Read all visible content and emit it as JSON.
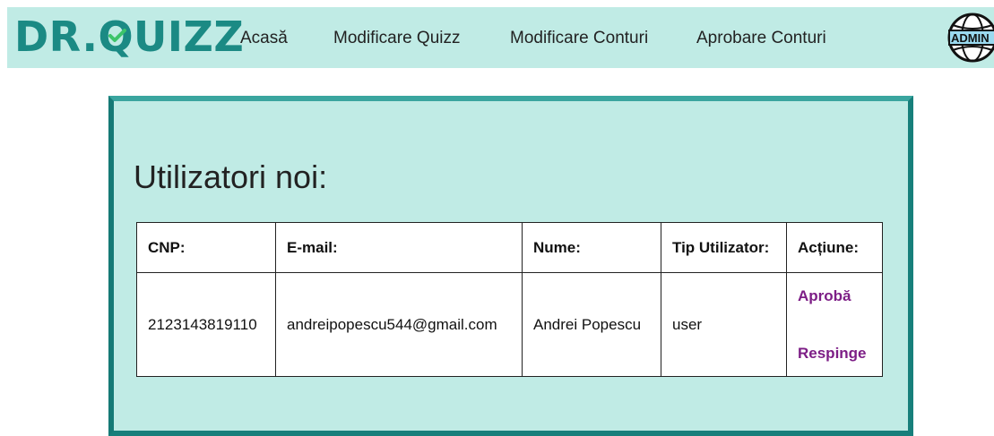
{
  "header": {
    "logo_text": "DR.QUIZZ",
    "nav": [
      {
        "label": "Acasă"
      },
      {
        "label": "Modificare Quizz"
      },
      {
        "label": "Modificare Conturi"
      },
      {
        "label": "Aprobare Conturi"
      }
    ],
    "admin_badge_text": "ADMIN"
  },
  "main": {
    "title": "Utilizatori noi:",
    "table": {
      "columns": [
        "CNP:",
        "E-mail:",
        "Nume:",
        "Tip Utilizator:",
        "Acțiune:"
      ],
      "rows": [
        {
          "cnp": "2123143819110",
          "email": "andreipopescu544@gmail.com",
          "nume": "Andrei Popescu",
          "tip": "user",
          "approve_label": "Aprobă",
          "reject_label": "Respinge"
        }
      ]
    }
  },
  "colors": {
    "header_bg": "#c0ebe5",
    "logo_teal": "#1b8a84",
    "check_green": "#3cc46a",
    "panel_border": "#177f7b",
    "action_purple": "#7d1e86"
  }
}
